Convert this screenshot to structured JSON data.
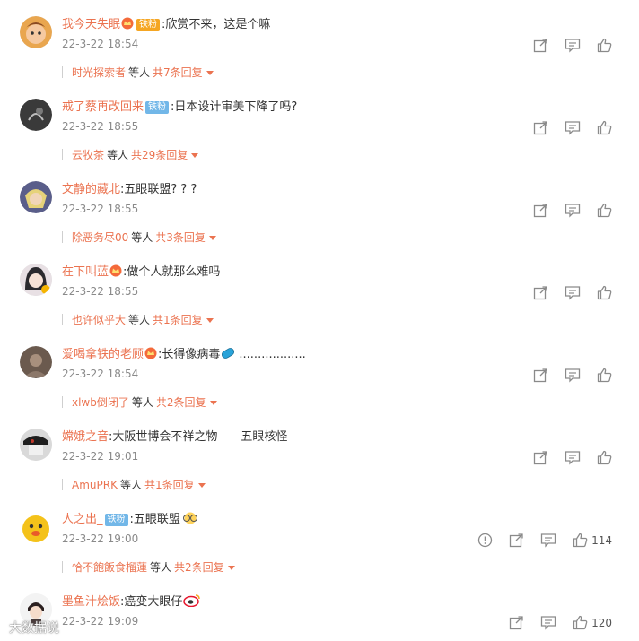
{
  "comments": [
    {
      "user": "我今天失眠",
      "badge": "",
      "vip": true,
      "text": ":欣赏不来，这是个嘛",
      "time": "22-3-22 18:54",
      "reply_user": "时光探索者",
      "reply_mid": "等人",
      "reply_count": "共7条回复",
      "likes": "",
      "avatar_color": "#d98a4b"
    },
    {
      "user": "戒了蔡再改回来",
      "badge": "铁粉",
      "vip": false,
      "text": ":日本设计审美下降了吗?",
      "time": "22-3-22 18:55",
      "reply_user": "云牧茶",
      "reply_mid": "等人",
      "reply_count": "共29条回复",
      "likes": "",
      "avatar_color": "#3a3a3a"
    },
    {
      "user": "文静的藏北",
      "badge": "",
      "vip": false,
      "text": ":五眼联盟? ? ?",
      "time": "22-3-22 18:55",
      "reply_user": "除恶务尽00",
      "reply_mid": "等人",
      "reply_count": "共3条回复",
      "likes": "",
      "avatar_color": "#5a5e8a"
    },
    {
      "user": "在下叫蓝",
      "badge": "",
      "vip": true,
      "text": ":做个人就那么难吗",
      "time": "22-3-22 18:55",
      "reply_user": "也许似乎大",
      "reply_mid": "等人",
      "reply_count": "共1条回复",
      "likes": "",
      "avatar_color": "#2b2a2e"
    },
    {
      "user": "爱喝拿铁的老顾",
      "badge": "",
      "vip": true,
      "text": ":长得像病毒",
      "text2": "..................",
      "time": "22-3-22 18:54",
      "reply_user": "xlwb倒闭了",
      "reply_mid": "等人",
      "reply_count": "共2条回复",
      "likes": "",
      "avatar_color": "#6b5a4e"
    },
    {
      "user": "嫦娥之音",
      "badge": "",
      "vip": false,
      "text": ":大阪世博会不祥之物——五眼核怪",
      "time": "22-3-22 19:01",
      "reply_user": "AmuPRK",
      "reply_mid": "等人",
      "reply_count": "共1条回复",
      "likes": "",
      "avatar_color": "#1e1e1e"
    },
    {
      "user": "人之出_",
      "badge": "铁粉",
      "vip": false,
      "text": ":五眼联盟",
      "time": "22-3-22 19:00",
      "reply_user": "恰不飽飯食榴蓮",
      "reply_mid": "等人",
      "reply_count": "共2条回复",
      "likes": "114",
      "avatar_color": "#f4c21a"
    },
    {
      "user": "墨鱼汁烩饭",
      "badge": "",
      "vip": false,
      "text": ":癌变大眼仔",
      "time": "22-3-22 19:09",
      "reply_user": "",
      "reply_mid": "",
      "reply_count": "",
      "likes": "120",
      "avatar_color": "#4a3c3c"
    }
  ],
  "watermark": "大数据说",
  "colors": {
    "accent": "#eb7350",
    "badge": "#72b7e8",
    "icon": "#8a8a8a"
  }
}
